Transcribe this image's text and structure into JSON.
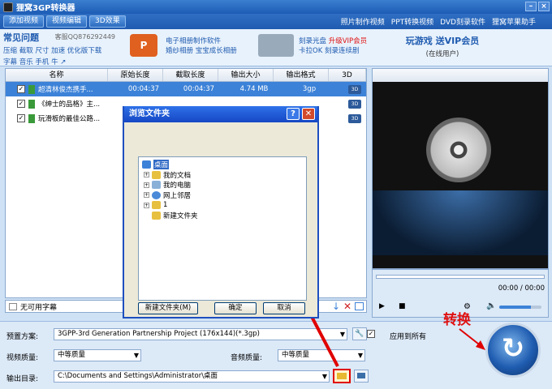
{
  "window": {
    "title": "狸窝3GP转换器"
  },
  "menu": {
    "add_video": "添加视频",
    "edit_video": "视频编辑",
    "effect_3d": "3D效果",
    "links": [
      "照片制作视频",
      "PPT转换视频",
      "DVD刻录软件",
      "狸窝苹果助手"
    ]
  },
  "promo": {
    "faq_title": "常见问题",
    "qq": "客服QQ876292449",
    "faq_row1": "压缩 截取 尺寸 加速 优化版下载",
    "faq_row2": "字幕 音乐 手机 牛 ↗",
    "ppt_lines": [
      "电子相册制作软件",
      "婚纱相册  宝宝成长相册"
    ],
    "burn_line1": "刻录光盘",
    "burn_vip": "升级VIP会员",
    "burn_line2": "卡拉OK  刻录连续剧",
    "vip_title": "玩游戏  送VIP会员",
    "vip_sub": "(在线用户)"
  },
  "list": {
    "headers": [
      "名称",
      "原始长度",
      "截取长度",
      "输出大小",
      "输出格式",
      "3D"
    ],
    "rows": [
      {
        "name": "超清林俊杰携手...",
        "orig": "00:04:37",
        "cut": "00:04:37",
        "size": "4.74 MB",
        "format": "3gp",
        "badge": "3D"
      },
      {
        "name": "《绅士的品格》主...",
        "orig": "",
        "cut": "",
        "size": "",
        "format": "",
        "badge": "3D"
      },
      {
        "name": "玩滑板的最佳公路...",
        "orig": "",
        "cut": "",
        "size": "",
        "format": "",
        "badge": "3D"
      }
    ]
  },
  "subtitle": "无可用字幕",
  "player": {
    "time": "00:00 / 00:00",
    "volume_fraction": 0.75
  },
  "form": {
    "preset_label": "预置方案:",
    "preset_value": "3GPP-3rd Generation Partnership Project (176x144)(*.3gp)",
    "apply_all": "应用到所有",
    "video_quality_label": "视频质量:",
    "video_quality": "中等质量",
    "audio_quality_label": "音频质量:",
    "audio_quality": "中等质量",
    "output_label": "输出目录:",
    "output_path": "C:\\Documents and Settings\\Administrator\\桌面"
  },
  "convert_annotation": "转换",
  "dialog": {
    "title": "浏览文件夹",
    "help": "?",
    "close": "✕",
    "tree": [
      {
        "label": "桌面",
        "level": 0,
        "icon": "desktop",
        "selected": true,
        "toggle": ""
      },
      {
        "label": "我的文档",
        "level": 1,
        "icon": "folder",
        "toggle": "+"
      },
      {
        "label": "我的电脑",
        "level": 1,
        "icon": "computer",
        "toggle": "+"
      },
      {
        "label": "网上邻居",
        "level": 1,
        "icon": "network",
        "toggle": "+"
      },
      {
        "label": "1",
        "level": 1,
        "icon": "folder",
        "toggle": "+"
      },
      {
        "label": "新建文件夹",
        "level": 1,
        "icon": "folder",
        "toggle": ""
      }
    ],
    "new_folder": "新建文件夹(M)",
    "ok": "确定",
    "cancel": "取消"
  },
  "colors": {
    "accent": "#3c82d8",
    "annotation": "#e00000"
  }
}
